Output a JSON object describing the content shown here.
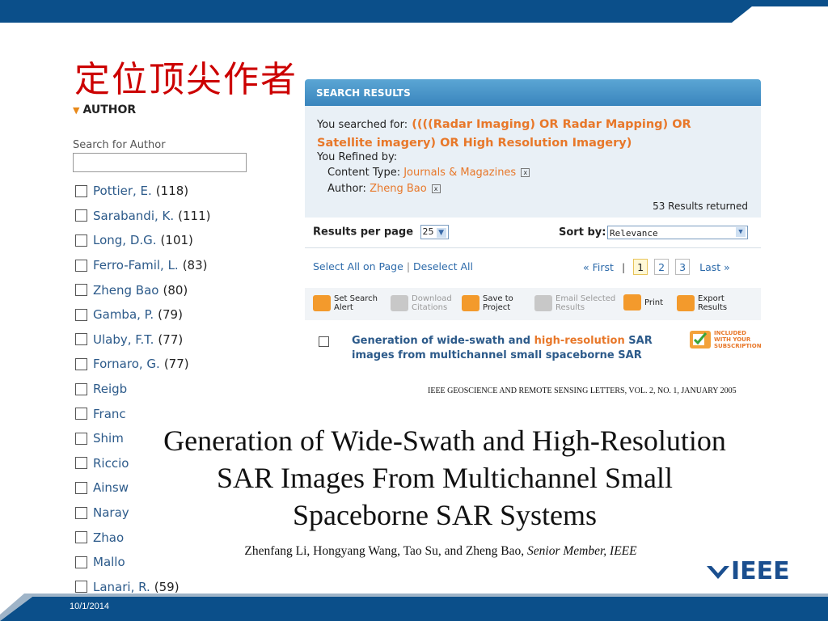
{
  "slide": {
    "title": "定位顶尖作者",
    "date": "10/1/2014",
    "colors": {
      "bar": "#0b4f8a",
      "title": "#cc0000",
      "accent": "#e8782a",
      "link": "#2c5a8a"
    }
  },
  "author_panel": {
    "heading": "AUTHOR",
    "search_label": "Search for Author",
    "search_value": "",
    "authors": [
      {
        "name": "Pottier, E.",
        "count": "(118)"
      },
      {
        "name": "Sarabandi, K.",
        "count": "(111)"
      },
      {
        "name": "Long, D.G.",
        "count": "(101)"
      },
      {
        "name": "Ferro-Famil, L.",
        "count": "(83)"
      },
      {
        "name": "Zheng Bao",
        "count": "(80)"
      },
      {
        "name": "Gamba, P.",
        "count": "(79)"
      },
      {
        "name": "Ulaby, F.T.",
        "count": "(77)"
      },
      {
        "name": "Fornaro, G.",
        "count": "(77)"
      },
      {
        "name": "Reigb",
        "count": ""
      },
      {
        "name": "Franc",
        "count": ""
      },
      {
        "name": "Shim",
        "count": ""
      },
      {
        "name": "Riccio",
        "count": ""
      },
      {
        "name": "Ainsw",
        "count": ""
      },
      {
        "name": "Naray",
        "count": ""
      },
      {
        "name": "Zhao",
        "count": ""
      },
      {
        "name": "Mallo",
        "count": ""
      },
      {
        "name": "Lanari, R.",
        "count": "(59)"
      }
    ]
  },
  "search_results": {
    "header": "SEARCH RESULTS",
    "searched_prefix": "You searched for:",
    "query": "((((Radar Imaging) OR Radar Mapping) OR Satellite imagery) OR High Resolution Imagery)",
    "refined_label": "You Refined by:",
    "refinements": [
      {
        "label": "Content Type:",
        "value": "Journals & Magazines"
      },
      {
        "label": "Author:",
        "value": "Zheng Bao"
      }
    ],
    "results_returned": "53 Results returned",
    "per_page_label": "Results per page",
    "per_page_value": "25",
    "sort_label": "Sort by:",
    "sort_value": "Relevance",
    "select_all": "Select All on Page",
    "deselect_all": "Deselect All",
    "pager": {
      "first": "« First",
      "pages": [
        "1",
        "2",
        "3"
      ],
      "current": "1",
      "last": "Last »"
    },
    "tools": [
      {
        "line1": "Set Search",
        "line2": "Alert",
        "enabled": true
      },
      {
        "line1": "Download",
        "line2": "Citations",
        "enabled": false
      },
      {
        "line1": "Save to",
        "line2": "Project",
        "enabled": true
      },
      {
        "line1": "Email Selected",
        "line2": "Results",
        "enabled": false
      },
      {
        "line1": "Print",
        "line2": "",
        "enabled": true
      },
      {
        "line1": "Export",
        "line2": "Results",
        "enabled": true
      }
    ],
    "result": {
      "title_a": "Generation of wide-swath and ",
      "title_hl": "high-resolution",
      "title_b": " SAR images from multichannel small spaceborne SAR",
      "badge": [
        "INCLUDED",
        "WITH YOUR",
        "SUBSCRIPTION"
      ]
    }
  },
  "paper": {
    "journal": "IEEE GEOSCIENCE AND REMOTE SENSING LETTERS, VOL. 2, NO. 1, JANUARY 2005",
    "title_lines": [
      "Generation of Wide-Swath and High-Resolution",
      "SAR Images From Multichannel Small",
      "Spaceborne SAR Systems"
    ],
    "authors": "Zhenfang Li, Hongyang Wang, Tao Su, and Zheng Bao,",
    "affiliation": "Senior Member, IEEE"
  },
  "logo": {
    "text": "IEEE"
  }
}
